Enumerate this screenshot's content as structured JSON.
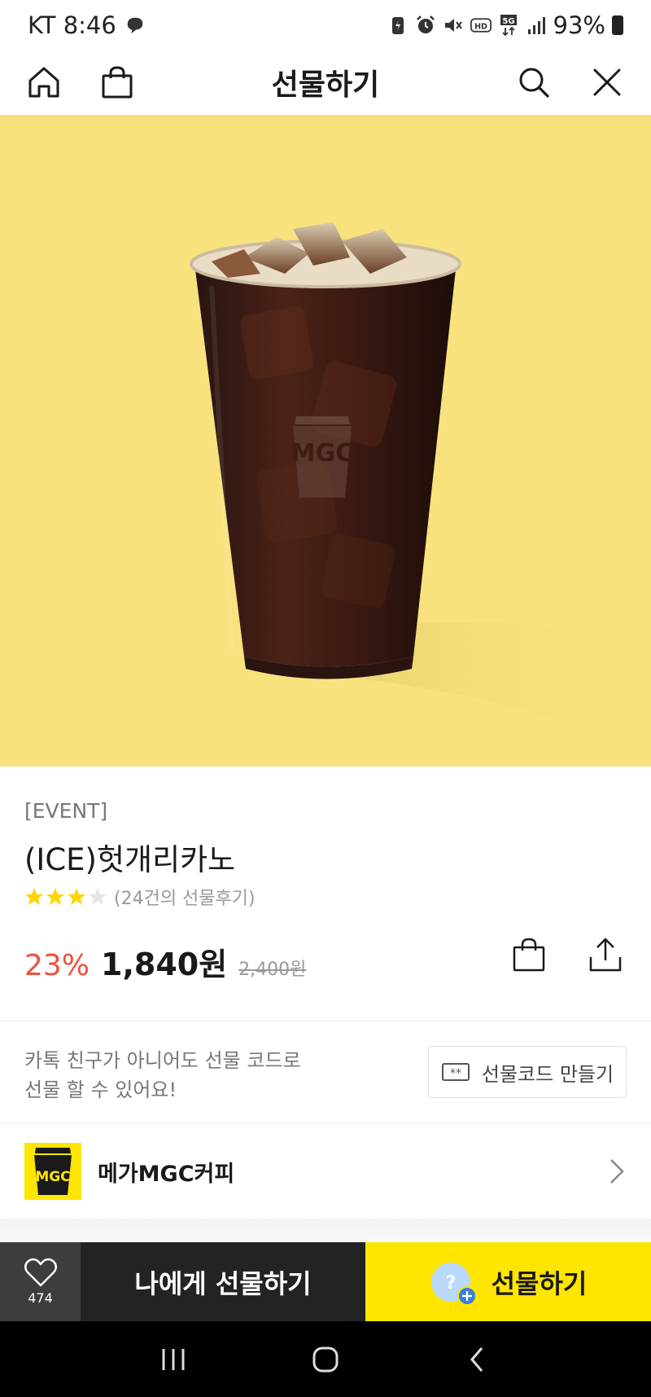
{
  "status_bar": {
    "carrier_time": "KT 8:46",
    "battery": "93%",
    "icons": [
      "messenger-icon",
      "battery-saver-icon",
      "alarm-icon",
      "mute-icon",
      "hd-voice-icon",
      "5g-icon",
      "signal-icon",
      "battery-icon"
    ]
  },
  "header": {
    "title": "선물하기",
    "left_icons": [
      "home-icon",
      "bag-icon"
    ],
    "right_icons": [
      "search-icon",
      "close-icon"
    ]
  },
  "hero": {
    "icon": "iced-coffee-cup-image",
    "cup_logo": "MGC",
    "background": "#f7e27e"
  },
  "product": {
    "event_tag": "[EVENT]",
    "name": "(ICE)헛개리카노",
    "rating": 3,
    "rating_max": 5,
    "review_text": "(24건의 선물후기)",
    "discount": "23%",
    "price": "1,840원",
    "original_price": "2,400원",
    "accent_color": "#f0503c"
  },
  "gift_code": {
    "line1": "카톡 친구가 아니어도 선물 코드로",
    "line2": "선물 할 수 있어요!",
    "button_label": "선물코드 만들기"
  },
  "brand": {
    "name": "메가MGC커피",
    "logo_text": "MGC",
    "logo_color": "#ffe500"
  },
  "bottom_bar": {
    "like_count": "474",
    "self_gift_label": "나에게 선물하기",
    "gift_label": "선물하기",
    "gift_avatar_mark": "?",
    "gift_color": "#ffe500"
  }
}
